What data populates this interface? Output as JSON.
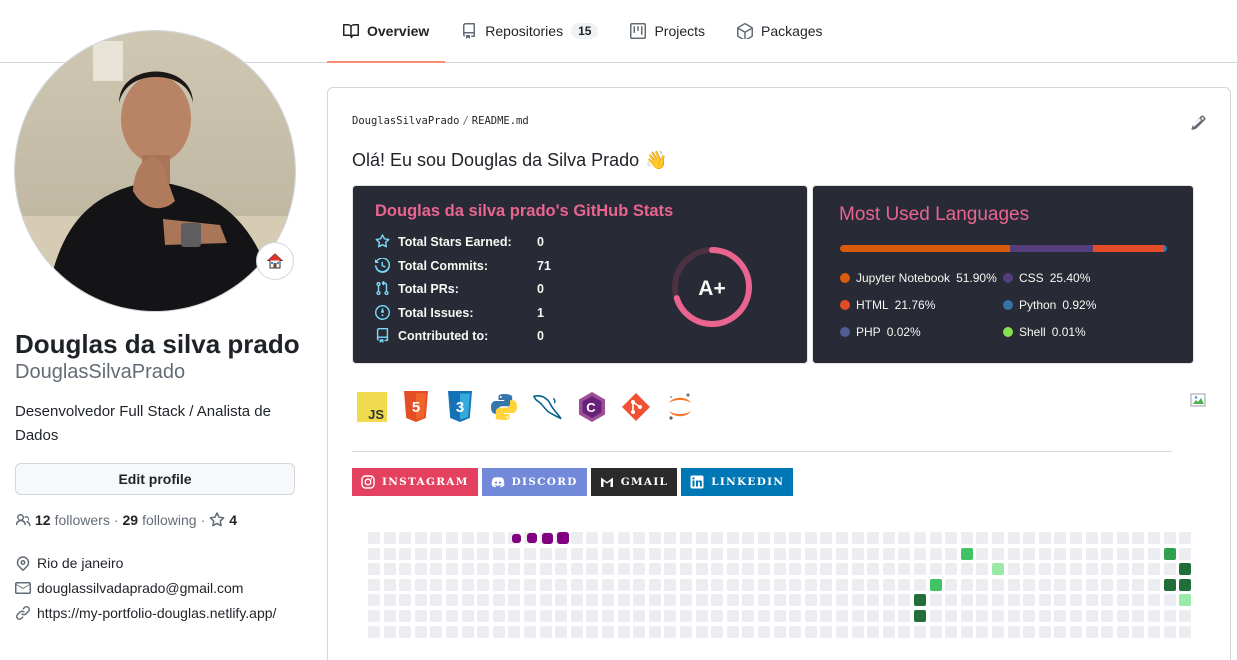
{
  "tabs": [
    {
      "label": "Overview",
      "active": true,
      "icon": "book-icon"
    },
    {
      "label": "Repositories",
      "count": "15",
      "icon": "repo-icon"
    },
    {
      "label": "Projects",
      "icon": "project-icon"
    },
    {
      "label": "Packages",
      "icon": "package-icon"
    }
  ],
  "profile": {
    "name": "Douglas da silva prado",
    "login": "DouglasSilvaPrado",
    "bio": "Desenvolvedor Full Stack / Analista de Dados",
    "edit_label": "Edit profile",
    "followers_count": "12",
    "followers_label": "followers",
    "following_count": "29",
    "following_label": "following",
    "separator": "·",
    "stars_count": "4",
    "location": "Rio de janeiro",
    "email": "douglassilvadaprado@gmail.com",
    "website": "https://my-portfolio-douglas.netlify.app/"
  },
  "readme": {
    "owner": "DouglasSilvaPrado",
    "separator": "/",
    "file": "README.md",
    "greeting": "Olá! Eu sou Douglas da Silva Prado",
    "wave_emoji": "👋"
  },
  "stats_card": {
    "title": "Douglas da silva prado's GitHub Stats",
    "rows": [
      {
        "label": "Total Stars Earned:",
        "value": "0",
        "icon": "star-icon"
      },
      {
        "label": "Total Commits:",
        "value": "71",
        "icon": "history-icon"
      },
      {
        "label": "Total PRs:",
        "value": "0",
        "icon": "pull-request-icon"
      },
      {
        "label": "Total Issues:",
        "value": "1",
        "icon": "issue-icon"
      },
      {
        "label": "Contributed to:",
        "value": "0",
        "icon": "repo-icon"
      }
    ],
    "grade": "A+",
    "grade_fraction": 0.7,
    "colors": {
      "bg": "#282a36",
      "title": "#e96590",
      "text": "#f8f8f2",
      "icon": "#79dafa"
    }
  },
  "lang_card": {
    "title": "Most Used Languages",
    "languages": [
      {
        "name": "Jupyter Notebook",
        "pct": "51.90%",
        "share": 51.9,
        "color": "#DA5B0B"
      },
      {
        "name": "CSS",
        "pct": "25.40%",
        "share": 25.4,
        "color": "#563d7c"
      },
      {
        "name": "HTML",
        "pct": "21.76%",
        "share": 21.76,
        "color": "#e34c26"
      },
      {
        "name": "Python",
        "pct": "0.92%",
        "share": 0.92,
        "color": "#3572A5"
      },
      {
        "name": "PHP",
        "pct": "0.02%",
        "share": 0.02,
        "color": "#4F5D95"
      },
      {
        "name": "Shell",
        "pct": "0.01%",
        "share": 0.01,
        "color": "#89e051"
      }
    ]
  },
  "tech_icons": [
    "javascript-icon",
    "html5-icon",
    "css3-icon",
    "python-icon",
    "mysql-icon",
    "csharp-icon",
    "git-icon",
    "jupyter-icon"
  ],
  "badges": [
    {
      "label": "INSTAGRAM",
      "color": "#E4405F",
      "icon": "instagram-icon"
    },
    {
      "label": "DISCORD",
      "color": "#7289DA",
      "icon": "discord-icon"
    },
    {
      "label": "GMAIL",
      "color": "#2a2a2a",
      "icon": "gmail-icon"
    },
    {
      "label": "LINKEDIN",
      "color": "#0077B5",
      "icon": "linkedin-icon"
    }
  ],
  "contribution_colors": {
    "empty": "#ebedf0",
    "l1": "#9be9a8",
    "l2": "#40c463",
    "l3": "#30a14e",
    "l4": "#216e39",
    "purple": "#800080"
  }
}
